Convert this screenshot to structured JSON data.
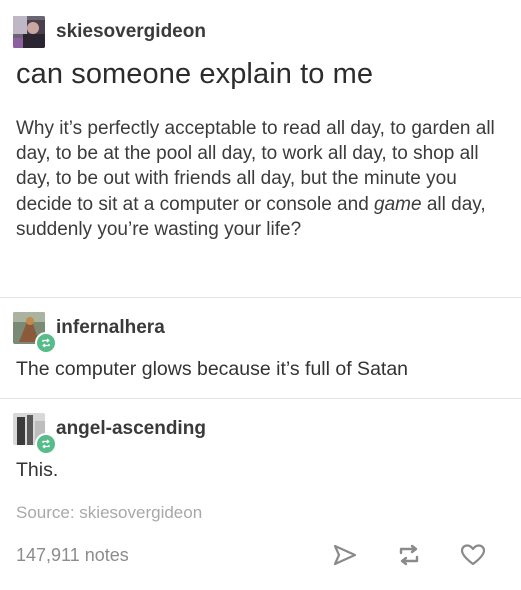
{
  "original_post": {
    "username": "skiesovergideon",
    "title": "can someone explain to me",
    "body_before_italic": "Why it’s perfectly acceptable to read all day, to garden all day, to be at the pool all day, to work all day, to shop all day, to be out with friends all day, but the minute you decide to sit at a computer or console and ",
    "body_italic": "game",
    "body_after_italic": " all day, suddenly you’re wasting your life?"
  },
  "reblogs": [
    {
      "username": "infernalhera",
      "text": "The computer glows because it’s full of Satan"
    },
    {
      "username": "angel-ascending",
      "text": "This."
    }
  ],
  "footer": {
    "source": "Source: skiesovergideon",
    "notes": "147,911 notes",
    "icons": [
      "share-icon",
      "reblog-icon",
      "heart-icon"
    ]
  },
  "colors": {
    "reblog_badge": "#56bc8a",
    "divider": "#e3e3e3"
  }
}
